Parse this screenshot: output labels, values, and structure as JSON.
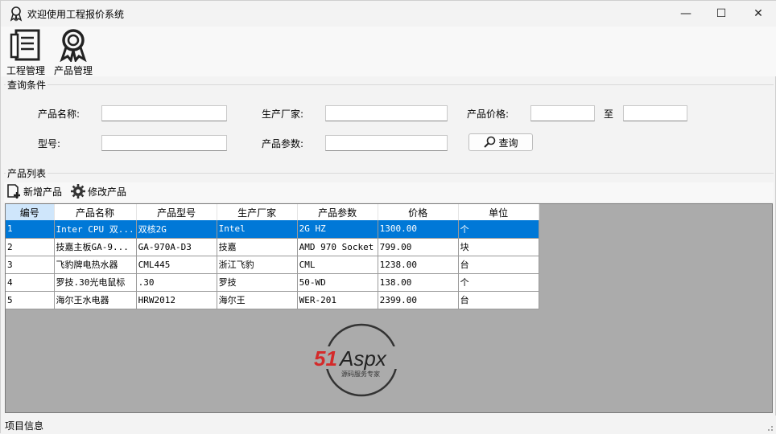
{
  "window": {
    "title": "欢迎使用工程报价系统",
    "minimize": "—",
    "maximize": "☐",
    "close": "✕"
  },
  "toolbar": {
    "project_label": "工程管理",
    "product_label": "产品管理"
  },
  "query": {
    "group_title": "查询条件",
    "name_label": "产品名称:",
    "maker_label": "生产厂家:",
    "price_label": "产品价格:",
    "to_label": "至",
    "model_label": "型号:",
    "param_label": "产品参数:",
    "search_label": "查询",
    "name_value": "",
    "maker_value": "",
    "price_from": "",
    "price_to": "",
    "model_value": "",
    "param_value": ""
  },
  "product_list": {
    "group_title": "产品列表",
    "add_label": "新增产品",
    "edit_label": "修改产品",
    "columns": [
      "编号",
      "产品名称",
      "产品型号",
      "生产厂家",
      "产品参数",
      "价格",
      "单位"
    ],
    "rows": [
      [
        "1",
        "Inter CPU 双...",
        "双核2G",
        "Intel",
        "2G HZ",
        "1300.00",
        "个"
      ],
      [
        "2",
        "技嘉主板GA-9...",
        "GA-970A-D3",
        "技嘉",
        "AMD 970 Socket",
        "799.00",
        "块"
      ],
      [
        "3",
        "飞豹牌电热水器",
        "CML445",
        "浙江飞豹",
        "CML",
        "1238.00",
        "台"
      ],
      [
        "4",
        "罗技.30光电鼠标",
        ".30",
        "罗技",
        "50-WD",
        "138.00",
        "个"
      ],
      [
        "5",
        "海尔王水电器",
        "HRW2012",
        "海尔王",
        "WER-201",
        "2399.00",
        "台"
      ]
    ],
    "selected_row": 0
  },
  "watermark": {
    "brand": "51Aspx",
    "tagline": "源码服务专家"
  },
  "status": {
    "text": "项目信息"
  },
  "colors": {
    "selection": "#0078d7",
    "grid_bg": "#ababab",
    "logo_red": "#d42a2a",
    "logo_green": "#3aa832"
  }
}
